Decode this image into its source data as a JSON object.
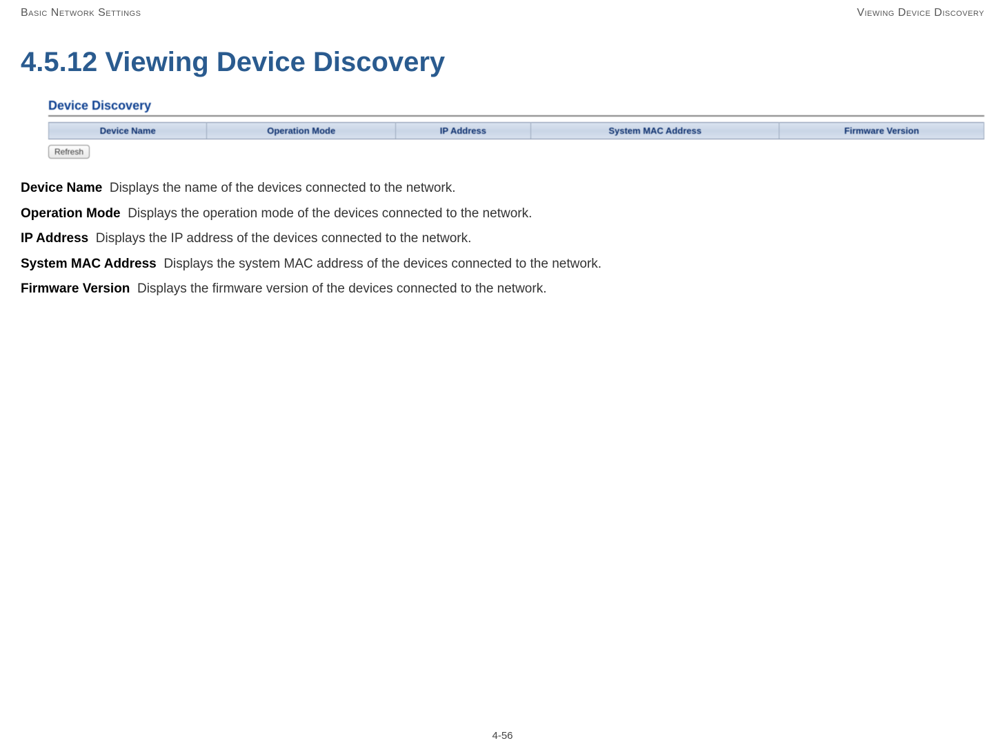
{
  "header": {
    "left": "Basic Network Settings",
    "right": "Viewing Device Discovery"
  },
  "section_title": "4.5.12 Viewing Device Discovery",
  "panel": {
    "title": "Device Discovery",
    "columns": [
      "Device Name",
      "Operation Mode",
      "IP Address",
      "System MAC Address",
      "Firmware Version"
    ],
    "refresh_label": "Refresh"
  },
  "definitions": [
    {
      "term": "Device Name",
      "desc": "Displays the name of the devices connected to the network."
    },
    {
      "term": "Operation Mode",
      "desc": "Displays the operation mode of the devices connected to the network."
    },
    {
      "term": "IP Address",
      "desc": "Displays the IP address of the devices connected to the network."
    },
    {
      "term": "System MAC Address",
      "desc": "Displays the system MAC address of the devices connected to the network."
    },
    {
      "term": "Firmware Version",
      "desc": "Displays the firmware version of the devices connected to the network."
    }
  ],
  "page_number": "4-56"
}
